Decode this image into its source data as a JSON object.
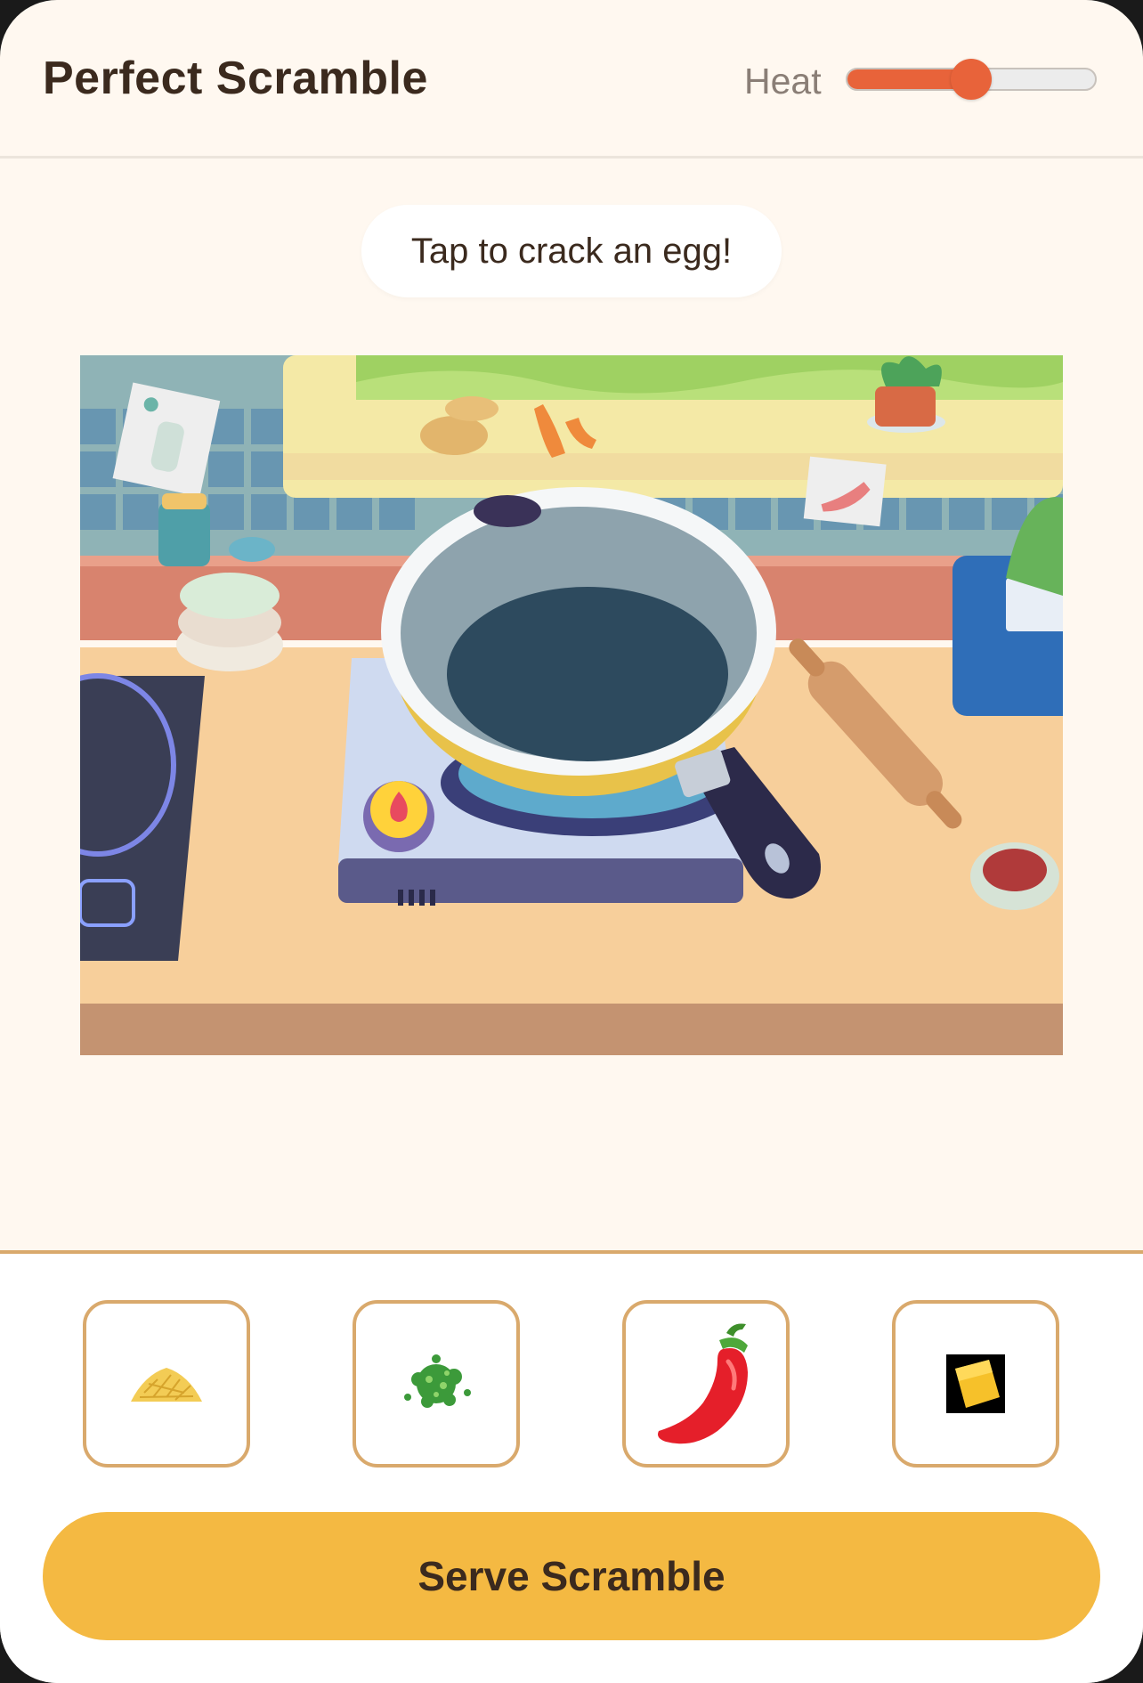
{
  "header": {
    "title": "Perfect Scramble",
    "heat_label": "Heat",
    "heat_level_fraction": 0.5
  },
  "prompt": {
    "text": "Tap to crack an egg!"
  },
  "ingredients": [
    {
      "name": "cheese-icon"
    },
    {
      "name": "chives-icon"
    },
    {
      "name": "chili-pepper-icon"
    },
    {
      "name": "butter-icon"
    }
  ],
  "actions": {
    "serve_label": "Serve Scramble"
  },
  "colors": {
    "accent": "#e8633a",
    "button": "#f4b942",
    "slot_border": "#d9a96c",
    "background": "#fff8f0"
  }
}
